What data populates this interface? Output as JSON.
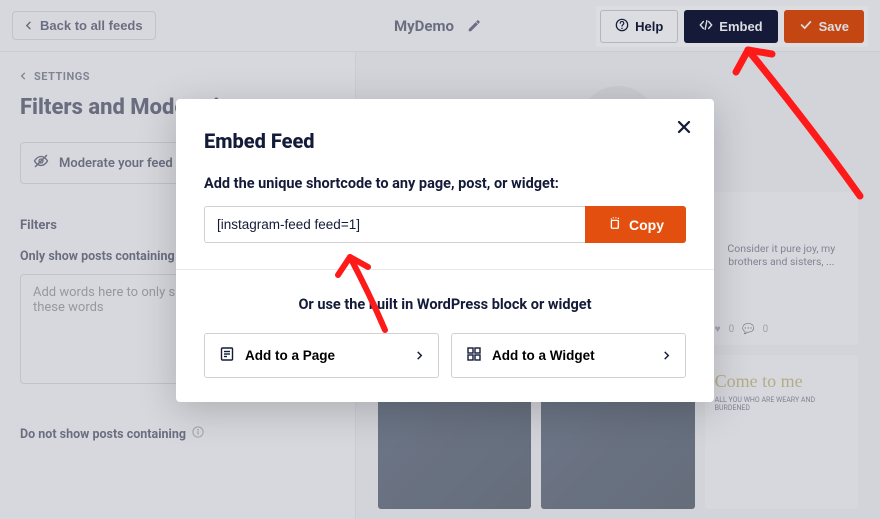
{
  "topbar": {
    "back_label": "Back to all feeds",
    "feed_name": "MyDemo",
    "help_label": "Help",
    "embed_label": "Embed",
    "save_label": "Save"
  },
  "sidebar": {
    "settings_label": "SETTINGS",
    "panel_title": "Filters and Moderation",
    "moderate_label": "Moderate your feed",
    "filters_heading": "Filters",
    "only_show_label": "Only show posts containing",
    "only_show_placeholder": "Add words here to only show posts containing these words",
    "do_not_show_label": "Do not show posts containing"
  },
  "preview": {
    "card4_caption": "Consider it pure joy, my brothers and sisters, ...",
    "card4_likes": "0",
    "card4_comments": "0",
    "card6_script": "Come to me",
    "card6_sub": "ALL YOU WHO ARE WEARY AND BURDENED"
  },
  "modal": {
    "title": "Embed Feed",
    "subtitle": "Add the unique shortcode to any page, post, or widget:",
    "shortcode": "[instagram-feed feed=1]",
    "copy_label": "Copy",
    "or_text": "Or use the built in WordPress block or widget",
    "add_page_label": "Add to a Page",
    "add_widget_label": "Add to a Widget"
  }
}
